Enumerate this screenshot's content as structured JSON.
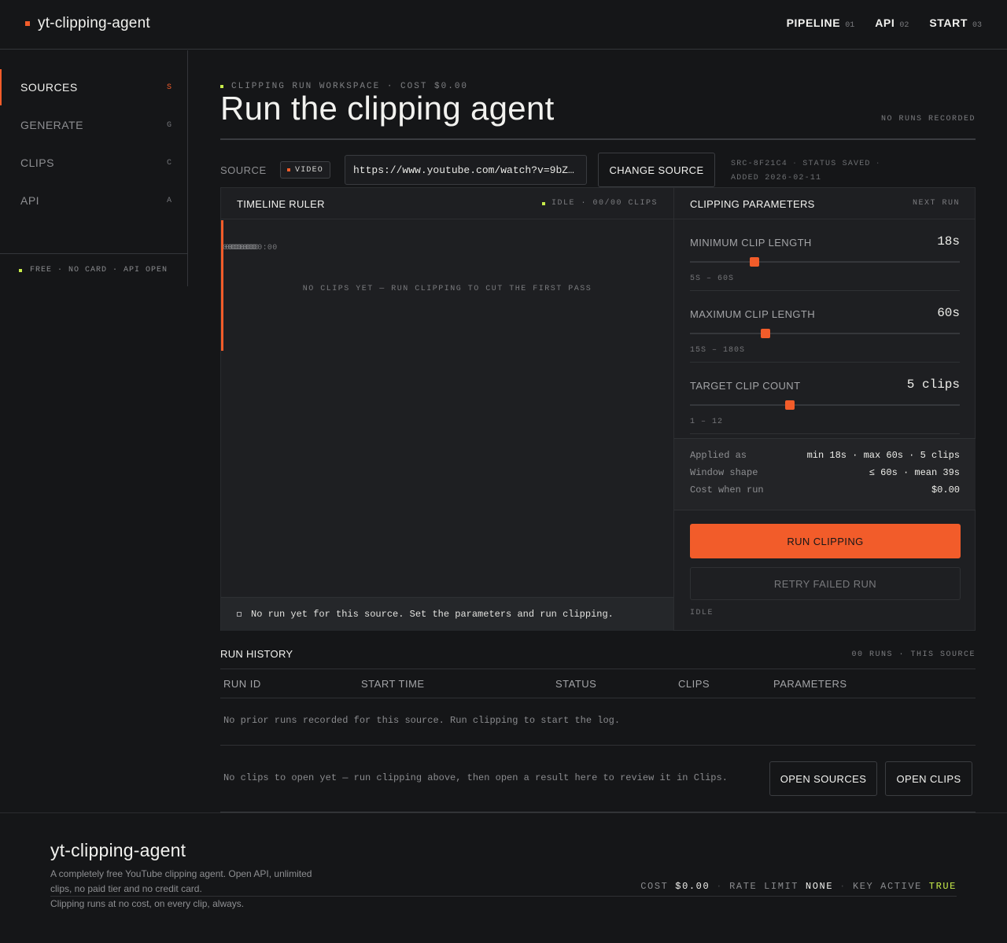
{
  "app": {
    "name": "yt-clipping-agent"
  },
  "topnav": [
    {
      "label": "PIPELINE",
      "num": "01"
    },
    {
      "label": "API",
      "num": "02"
    },
    {
      "label": "START",
      "num": "03"
    }
  ],
  "sidebar": {
    "items": [
      {
        "label": "SOURCES",
        "key": "S"
      },
      {
        "label": "GENERATE",
        "key": "G"
      },
      {
        "label": "CLIPS",
        "key": "C"
      },
      {
        "label": "API",
        "key": "A"
      }
    ],
    "footer": "FREE · NO CARD · API OPEN"
  },
  "header": {
    "eyebrow": "CLIPPING RUN WORKSPACE · COST $0.00",
    "title": "Run the clipping agent",
    "no_runs": "NO RUNS RECORDED"
  },
  "source": {
    "label": "SOURCE",
    "badge": "VIDEO",
    "url": "https://www.youtube.com/watch?v=9bZ…",
    "change_label": "CHANGE SOURCE",
    "meta_id": "SRC-8F21C4",
    "meta_status": "STATUS SAVED",
    "meta_added": "ADDED 2026-02-11"
  },
  "timeline": {
    "title": "TIMELINE RULER",
    "status": "IDLE · 00/00 CLIPS",
    "ticks": [
      "00:00",
      "00:00",
      "00:00",
      "00:00",
      "00:00",
      "00:00"
    ],
    "empty": "NO CLIPS YET — RUN CLIPPING TO CUT THE FIRST PASS",
    "note": "No run yet for this source. Set the parameters and run clipping."
  },
  "params": {
    "title": "CLIPPING PARAMETERS",
    "next": "NEXT RUN",
    "items": [
      {
        "label": "MINIMUM CLIP LENGTH",
        "value": "18s",
        "range": "5S – 60S",
        "level": 0.24
      },
      {
        "label": "MAXIMUM CLIP LENGTH",
        "value": "60s",
        "range": "15S – 180S",
        "level": 0.28
      },
      {
        "label": "TARGET CLIP COUNT",
        "value": "5 clips",
        "range": "1 – 12",
        "level": 0.37
      }
    ],
    "summary": [
      {
        "k": "Applied as",
        "v": "min 18s · max 60s · 5 clips"
      },
      {
        "k": "Window shape",
        "v": "≤ 60s · mean 39s"
      },
      {
        "k": "Cost when run",
        "v": "$0.00"
      }
    ],
    "run_label": "RUN CLIPPING",
    "retry_label": "RETRY FAILED RUN",
    "state": "IDLE"
  },
  "history": {
    "title": "RUN HISTORY",
    "count": "00 RUNS · THIS SOURCE",
    "columns": [
      "RUN ID",
      "START TIME",
      "STATUS",
      "CLIPS",
      "PARAMETERS"
    ],
    "empty": "No prior runs recorded for this source. Run clipping to start the log.",
    "open_text": "No clips to open yet — run clipping above, then open a result here to review it in Clips.",
    "open_sources": "OPEN SOURCES",
    "open_clips": "OPEN CLIPS"
  },
  "footer": {
    "name": "yt-clipping-agent",
    "desc": "A completely free YouTube clipping agent. Open API, unlimited clips, no paid tier and no credit card.",
    "tagline": "Clipping runs at no cost, on every clip, always.",
    "cost_label": "COST",
    "cost_value": "$0.00",
    "rate_label": "RATE LIMIT",
    "rate_value": "NONE",
    "key_label": "KEY ACTIVE",
    "key_value": "TRUE"
  },
  "colors": {
    "accent": "#f25c2a",
    "lime": "#c8ec4a",
    "bg": "#151618"
  }
}
